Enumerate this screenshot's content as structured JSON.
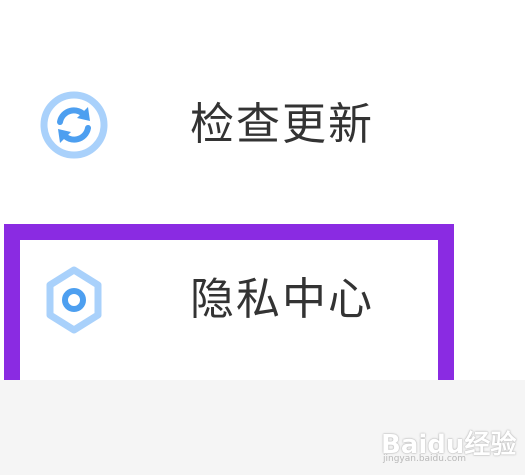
{
  "menu": {
    "items": [
      {
        "label": "检查更新",
        "icon": "refresh-icon"
      },
      {
        "label": "隐私中心",
        "icon": "gear-icon"
      }
    ]
  },
  "colors": {
    "icon_blue": "#6aaef2",
    "icon_light": "#a9d1fb",
    "highlight": "#8a2be2",
    "text": "#333333",
    "band": "#f5f5f5"
  },
  "watermark": {
    "brand": "Baidu经验",
    "url": "jingyan.baidu.com"
  }
}
